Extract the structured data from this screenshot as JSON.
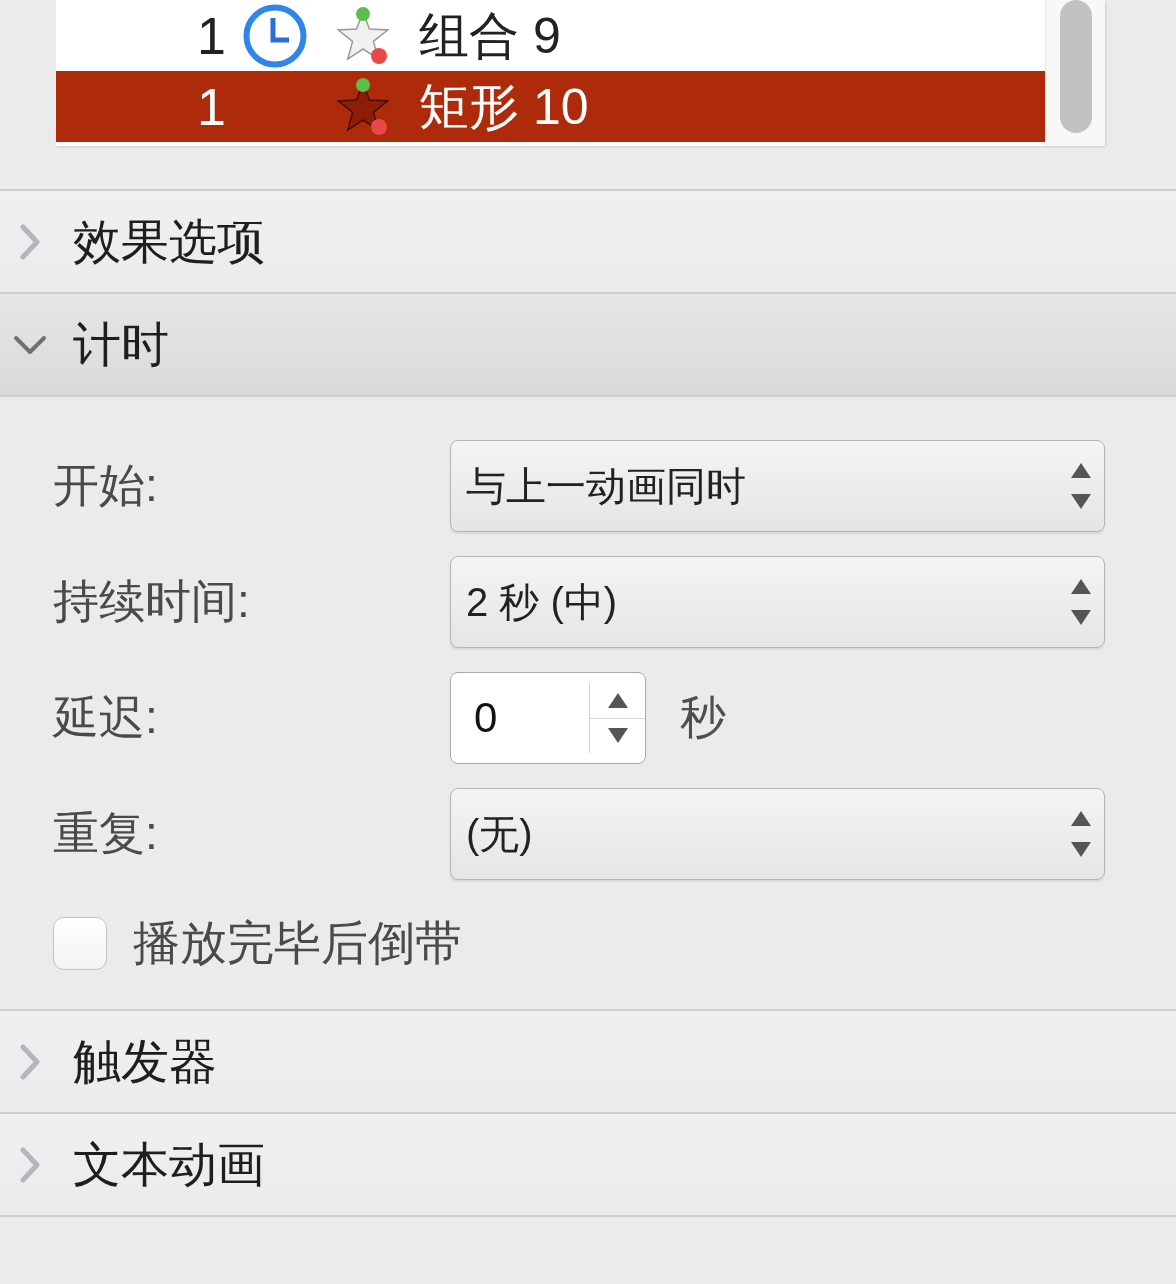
{
  "animation_list": {
    "rows": [
      {
        "order": "1",
        "clock": true,
        "name": "组合 9",
        "selected": false
      },
      {
        "order": "1",
        "clock": false,
        "name": "矩形 10",
        "selected": true
      }
    ]
  },
  "sections": [
    {
      "title": "效果选项",
      "expanded": false
    },
    {
      "title": "计时",
      "expanded": true,
      "fields": [
        {
          "kind": "select",
          "label": "开始:",
          "value": "与上一动画同时"
        },
        {
          "kind": "select",
          "label": "持续时间:",
          "value": "2 秒 (中)"
        },
        {
          "kind": "spinner",
          "label": "延迟:",
          "value": "0",
          "unit": "秒"
        },
        {
          "kind": "select",
          "label": "重复:",
          "value": "(无)"
        },
        {
          "kind": "checkbox",
          "label": "播放完毕后倒带",
          "checked": false
        }
      ]
    },
    {
      "title": "触发器",
      "expanded": false
    },
    {
      "title": "文本动画",
      "expanded": false
    }
  ]
}
